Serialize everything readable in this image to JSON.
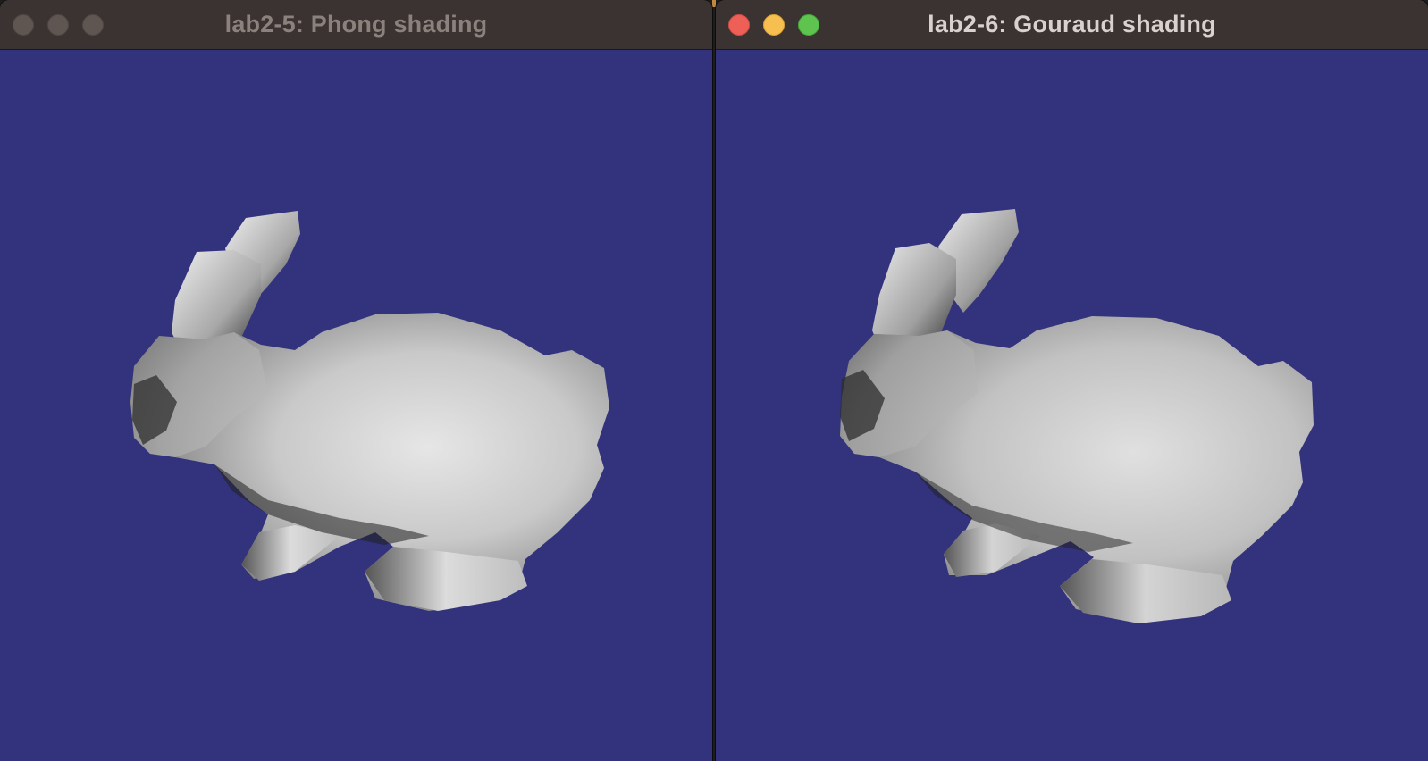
{
  "windows": [
    {
      "id": "left",
      "title": "lab2-5: Phong shading",
      "state": "inactive",
      "background_color": "#33337d"
    },
    {
      "id": "right",
      "title": "lab2-6: Gouraud shading",
      "state": "active",
      "background_color": "#33337d"
    }
  ],
  "colors": {
    "titlebar": "#3a3331",
    "close": "#ee5f57",
    "minimize": "#f6bf4f",
    "maximize": "#5ec44f"
  },
  "icons": {
    "close": "close-dot-icon",
    "minimize": "minimize-dot-icon",
    "maximize": "maximize-dot-icon"
  }
}
